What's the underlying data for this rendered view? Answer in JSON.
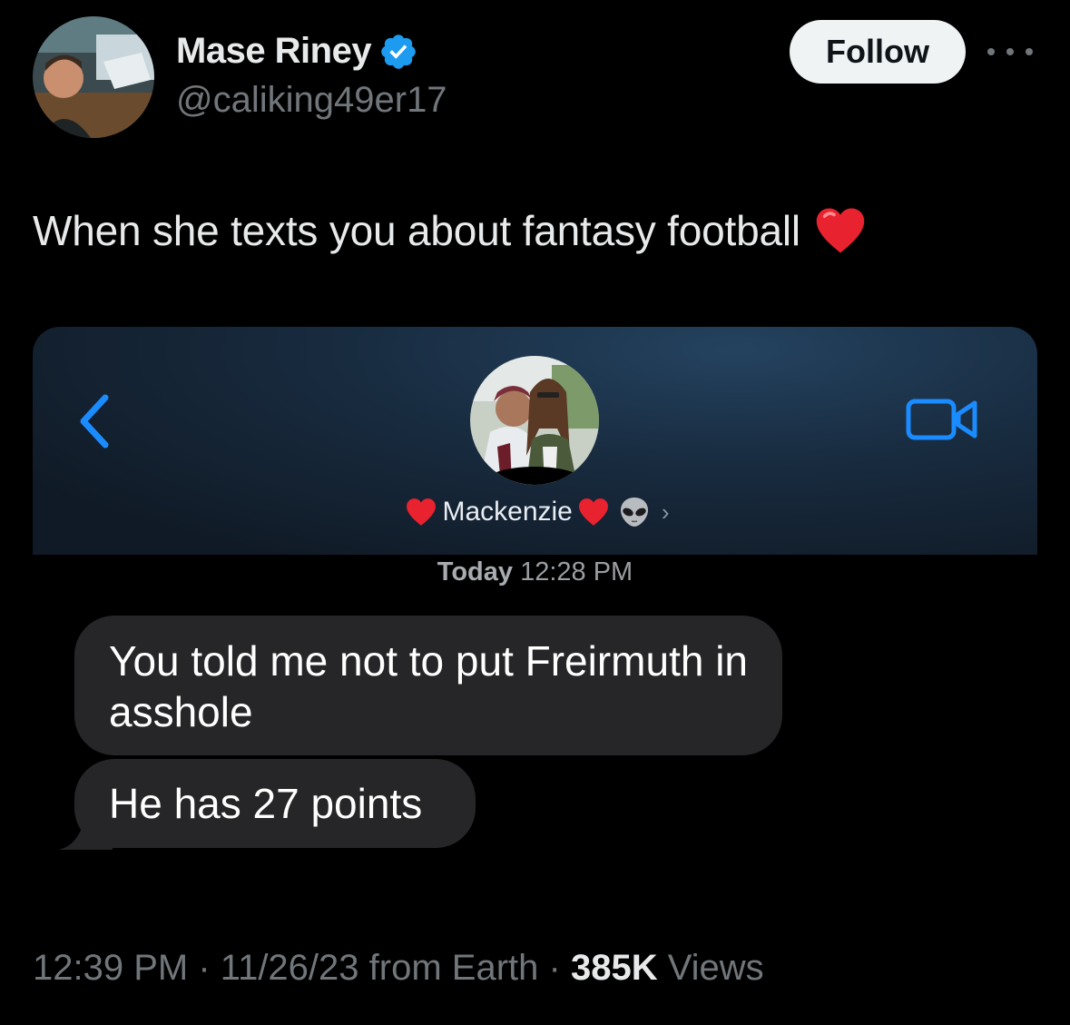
{
  "author": {
    "name": "Mase Riney",
    "handle": "@caliking49er17",
    "verified": true,
    "accent_color": "#1d9bf0"
  },
  "actions": {
    "follow_label": "Follow",
    "more_icon": "more-horizontal-icon"
  },
  "tweet": {
    "text": "When she texts you about fantasy football",
    "emoji": "red-heart-icon"
  },
  "screenshot": {
    "contact_name": "Mackenzie",
    "timestamp_day": "Today",
    "timestamp_time": "12:28 PM",
    "messages": [
      {
        "text": "You told me not to put Freirmuth in asshole"
      },
      {
        "text": "He has 27 points"
      }
    ]
  },
  "meta": {
    "time": "12:39 PM",
    "date": "11/26/23",
    "location": "from Earth",
    "views_count": "385K",
    "views_label": "Views",
    "separator": "·"
  }
}
